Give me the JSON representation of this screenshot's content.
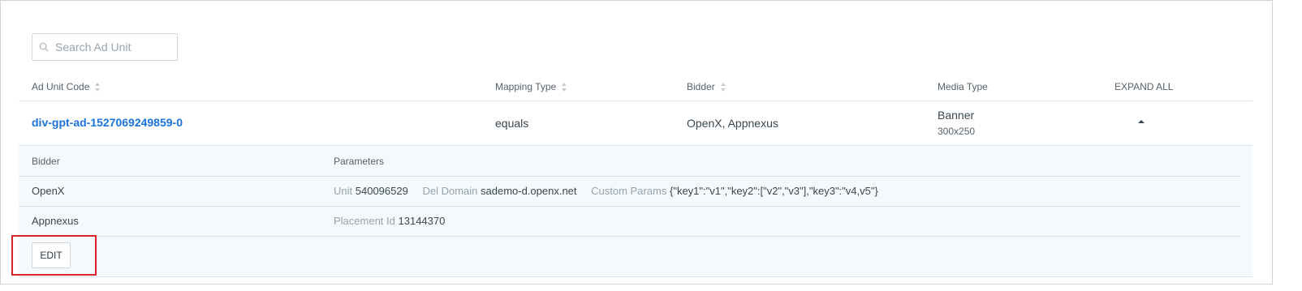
{
  "search": {
    "placeholder": "Search Ad Unit",
    "value": ""
  },
  "table": {
    "headers": {
      "ad_unit_code": "Ad Unit Code",
      "mapping_type": "Mapping Type",
      "bidder": "Bidder",
      "media_type": "Media Type",
      "expand_all": "EXPAND ALL"
    },
    "row": {
      "ad_unit_code": "div-gpt-ad-1527069249859-0",
      "mapping_type": "equals",
      "bidder": "OpenX, Appnexus",
      "media_type": "Banner",
      "media_size": "300x250"
    }
  },
  "details": {
    "headers": {
      "bidder": "Bidder",
      "parameters": "Parameters"
    },
    "rows": [
      {
        "bidder": "OpenX",
        "params": [
          {
            "key": "Unit",
            "value": "540096529"
          },
          {
            "key": "Del Domain",
            "value": "sademo-d.openx.net"
          },
          {
            "key": "Custom Params",
            "value": "{\"key1\":\"v1\",\"key2\":[\"v2\",\"v3\"],\"key3\":\"v4,v5\"}"
          }
        ]
      },
      {
        "bidder": "Appnexus",
        "params": [
          {
            "key": "Placement Id",
            "value": "13144370"
          }
        ]
      }
    ],
    "edit_label": "EDIT"
  },
  "colors": {
    "link": "#1a73d9",
    "highlight": "#d9262c",
    "panel_bg": "#f5f9fb"
  }
}
